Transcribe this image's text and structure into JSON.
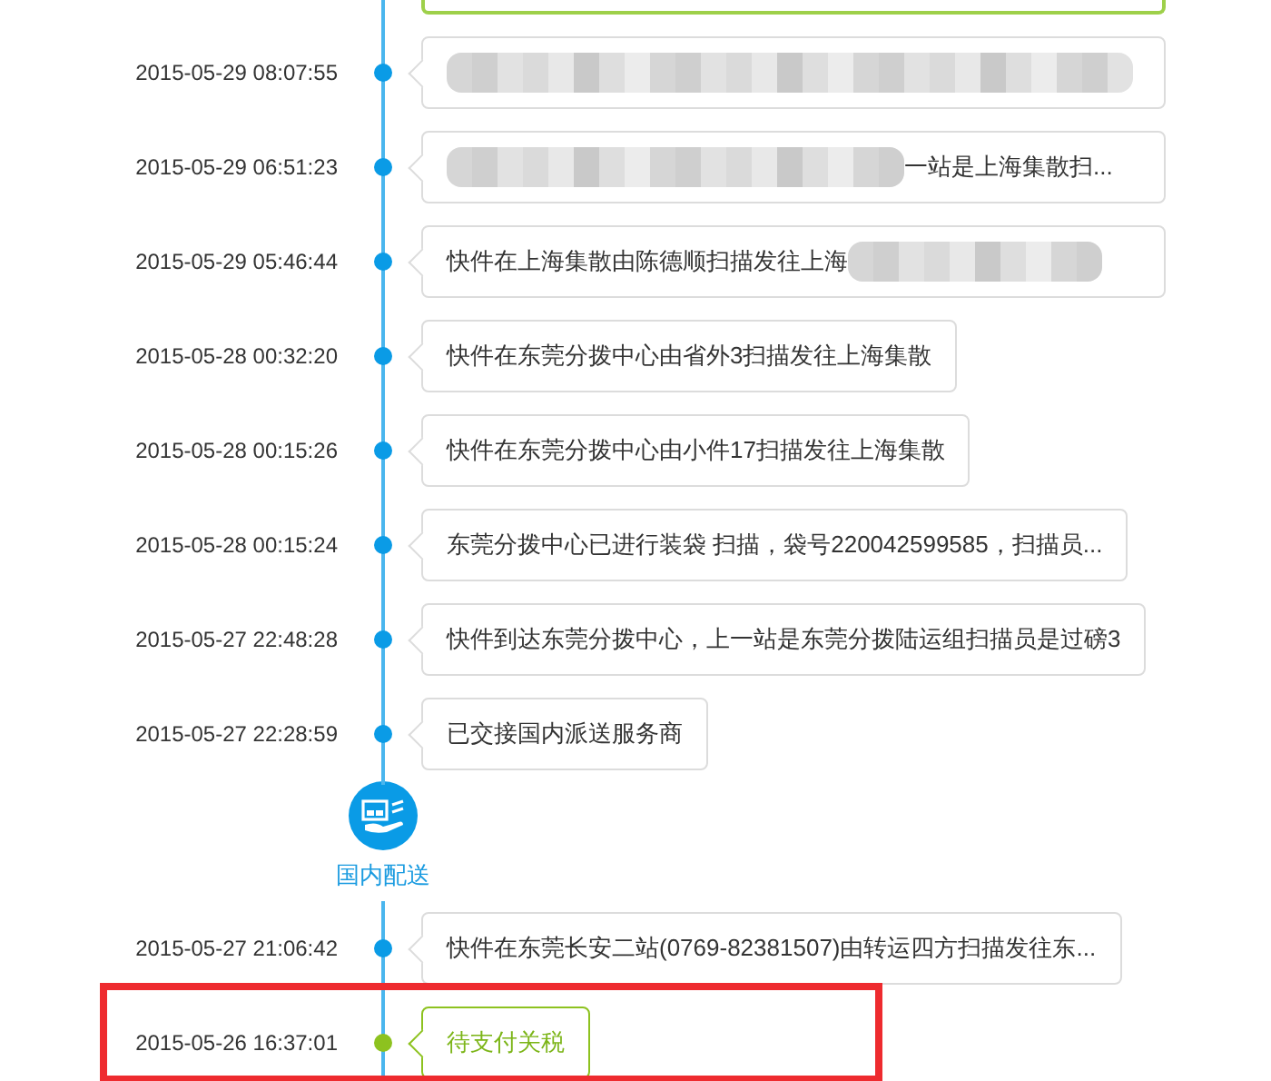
{
  "entries": [
    {
      "kind": "cutoff",
      "current": true
    },
    {
      "kind": "event",
      "time": "2015-05-29 08:07:55",
      "blur_before": true,
      "blur_after": false,
      "current": false,
      "annotated": false
    },
    {
      "kind": "event",
      "time": "2015-05-29 06:51:23",
      "text": "一站是上海集散扫...",
      "blur_before": true,
      "blur_after": false,
      "current": false,
      "annotated": false
    },
    {
      "kind": "event",
      "time": "2015-05-29 05:46:44",
      "text": "快件在上海集散由陈德顺扫描发往上海",
      "blur_before": false,
      "blur_after": true,
      "current": false,
      "annotated": false
    },
    {
      "kind": "event",
      "time": "2015-05-28 00:32:20",
      "text": "快件在东莞分拨中心由省外3扫描发往上海集散",
      "current": false,
      "annotated": false
    },
    {
      "kind": "event",
      "time": "2015-05-28 00:15:26",
      "text": "快件在东莞分拨中心由小件17扫描发往上海集散",
      "current": false,
      "annotated": false
    },
    {
      "kind": "event",
      "time": "2015-05-28 00:15:24",
      "text": "东莞分拨中心已进行装袋 扫描，袋号220042599585，扫描员...",
      "current": false,
      "annotated": false
    },
    {
      "kind": "event",
      "time": "2015-05-27 22:48:28",
      "text": "快件到达东莞分拨中心，上一站是东莞分拨陆运组扫描员是过磅3",
      "current": false,
      "annotated": false
    },
    {
      "kind": "event",
      "time": "2015-05-27 22:28:59",
      "text": "已交接国内派送服务商",
      "current": false,
      "annotated": false
    },
    {
      "kind": "phase",
      "label": "国内配送"
    },
    {
      "kind": "event",
      "time": "2015-05-27 21:06:42",
      "text": "快件在东莞长安二站(0769-82381507)由转运四方扫描发往东...",
      "current": false,
      "annotated": false
    },
    {
      "kind": "event",
      "time": "2015-05-26 16:37:01",
      "text": "待支付关税",
      "current": true,
      "annotated": true
    }
  ]
}
